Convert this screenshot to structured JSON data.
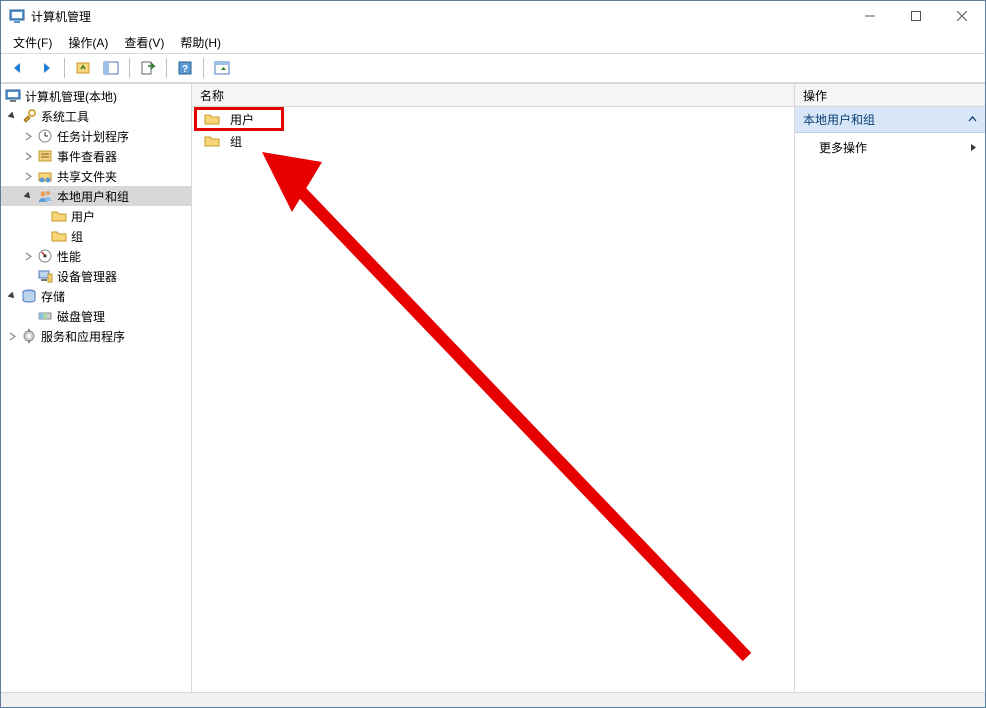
{
  "title": "计算机管理",
  "menus": [
    "文件(F)",
    "操作(A)",
    "查看(V)",
    "帮助(H)"
  ],
  "tree": {
    "root": {
      "label": "计算机管理(本地)"
    },
    "system_tools": {
      "label": "系统工具"
    },
    "task_scheduler": {
      "label": "任务计划程序"
    },
    "event_viewer": {
      "label": "事件查看器"
    },
    "shared_folders": {
      "label": "共享文件夹"
    },
    "local_users_groups": {
      "label": "本地用户和组"
    },
    "users": {
      "label": "用户"
    },
    "groups": {
      "label": "组"
    },
    "performance": {
      "label": "性能"
    },
    "device_manager": {
      "label": "设备管理器"
    },
    "storage": {
      "label": "存储"
    },
    "disk_mgmt": {
      "label": "磁盘管理"
    },
    "services_apps": {
      "label": "服务和应用程序"
    }
  },
  "list": {
    "header": "名称",
    "items": [
      {
        "label": "用户"
      },
      {
        "label": "组"
      }
    ]
  },
  "actions": {
    "header": "操作",
    "section": "本地用户和组",
    "more": "更多操作"
  }
}
